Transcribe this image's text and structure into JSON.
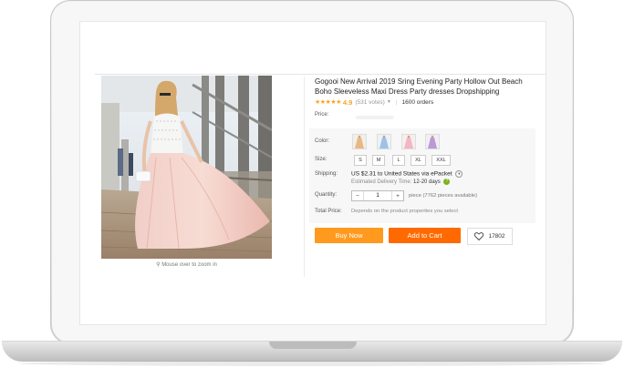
{
  "product": {
    "title": "Gogooi New Arrival 2019 Sring Evening Party Hollow Out Beach Boho Sleeveless Maxi Dress Party dresses Dropshipping",
    "rating": "4.9",
    "votes": "(531 votes)",
    "orders": "1600 orders",
    "zoom_hint": "Mouse over to zoom in"
  },
  "labels": {
    "price": "Price:",
    "color": "Color:",
    "size": "Size:",
    "shipping": "Shipping:",
    "quantity": "Quantity:",
    "total": "Total Price:"
  },
  "sizes": [
    "S",
    "M",
    "L",
    "XL",
    "XXL"
  ],
  "colors": [
    {
      "icon": "dress-swatch-icon",
      "accent": "#e8b884"
    },
    {
      "icon": "dress-swatch-icon",
      "accent": "#9ec1e8"
    },
    {
      "icon": "dress-swatch-icon",
      "accent": "#f2b6c4"
    },
    {
      "icon": "dress-swatch-icon",
      "accent": "#b99ad6"
    }
  ],
  "shipping": {
    "price": "US $2.31",
    "destination": "to United States via ePacket",
    "delivery_label": "Estimated Delivery Time:",
    "delivery_days": "12-20 days"
  },
  "quantity": {
    "value": "1",
    "minus": "−",
    "plus": "+",
    "available": "piece (7762 pieces available)"
  },
  "total_note": "Depends on the product properties you select",
  "buttons": {
    "buy_now": "Buy Now",
    "add_to_cart": "Add to Cart",
    "wishlist_count": "17802"
  },
  "theme": {
    "buy_now_color": "#ff9a1e",
    "add_to_cart_color": "#ff6a00",
    "star_color": "#f5a623"
  }
}
